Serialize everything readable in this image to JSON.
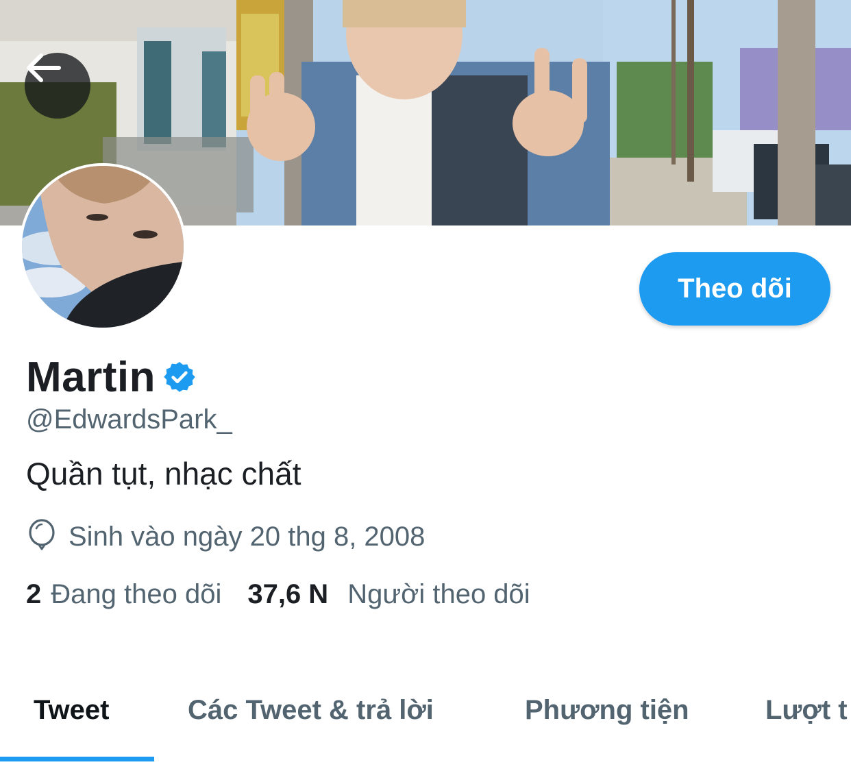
{
  "profile": {
    "display_name": "Martin",
    "handle": "@EdwardsPark_",
    "bio": "Quần tụt, nhạc chất",
    "birth": "Sinh vào ngày 20 thg 8, 2008",
    "verified": true
  },
  "actions": {
    "back_icon": "back-arrow-icon",
    "follow_label": "Theo dõi"
  },
  "stats": {
    "following_count": "2",
    "following_label": "Đang theo dõi",
    "followers_count": "37,6 N",
    "followers_label": "Người theo dõi"
  },
  "tabs": [
    {
      "label": "Tweet",
      "active": true
    },
    {
      "label": "Các Tweet & trả lời",
      "active": false
    },
    {
      "label": "Phương tiện",
      "active": false
    },
    {
      "label": "Lượt t",
      "active": false
    }
  ],
  "colors": {
    "accent": "#1d9bf0",
    "text_primary": "#0f1419",
    "text_secondary": "#536471"
  }
}
